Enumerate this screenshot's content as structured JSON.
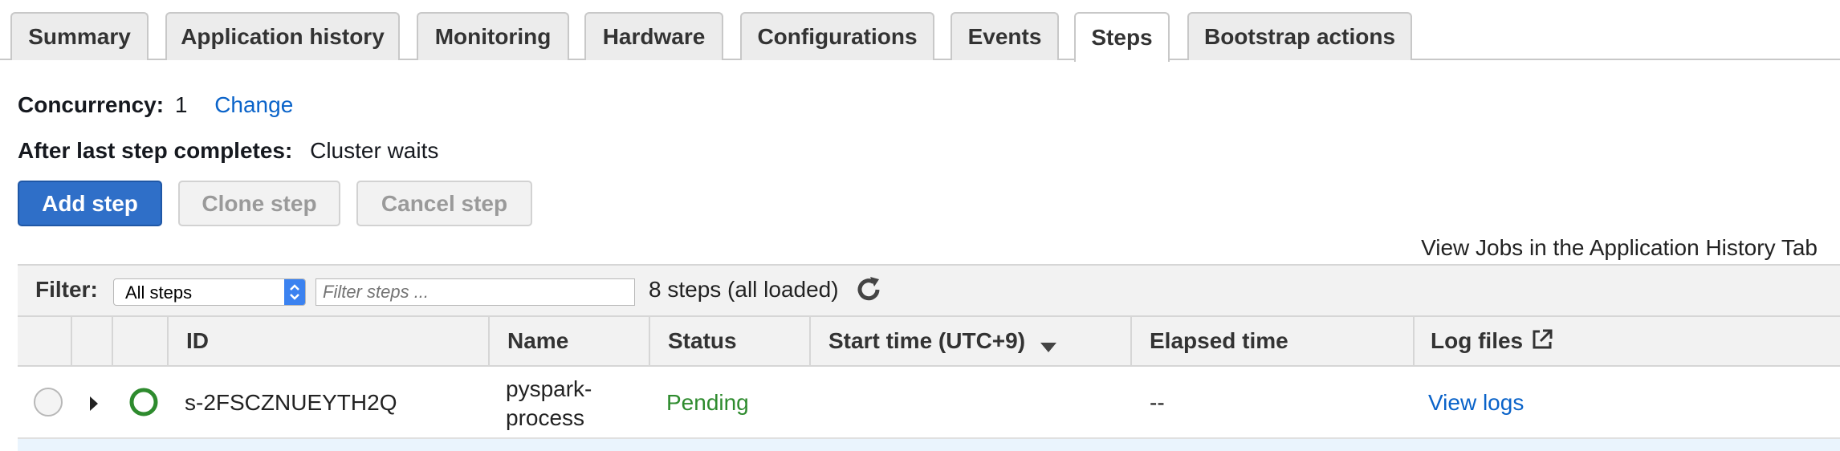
{
  "tabs": [
    {
      "label": "Summary"
    },
    {
      "label": "Application history"
    },
    {
      "label": "Monitoring"
    },
    {
      "label": "Hardware"
    },
    {
      "label": "Configurations"
    },
    {
      "label": "Events"
    },
    {
      "label": "Steps",
      "active": true
    },
    {
      "label": "Bootstrap actions"
    }
  ],
  "concurrency": {
    "label": "Concurrency:",
    "value": "1",
    "change_link": "Change"
  },
  "after_last_step": {
    "label": "After last step completes:",
    "value": "Cluster waits"
  },
  "buttons": {
    "add": "Add step",
    "clone": "Clone step",
    "cancel": "Cancel step"
  },
  "view_jobs_link": "View Jobs in the Application History Tab",
  "filter": {
    "label": "Filter:",
    "select_value": "All steps",
    "input_placeholder": "Filter steps ...",
    "count_text": "8 steps (all loaded)"
  },
  "table": {
    "columns": {
      "id": "ID",
      "name": "Name",
      "status": "Status",
      "start_time": "Start time (UTC+9)",
      "elapsed": "Elapsed time",
      "log_files": "Log files"
    },
    "rows": [
      {
        "id": "s-2FSCZNUEYTH2Q",
        "name_line1": "pyspark-",
        "name_line2": "process",
        "status": "Pending",
        "start_time": "",
        "elapsed": "--",
        "log_link": "View logs"
      }
    ]
  },
  "colors": {
    "link": "#0a63c9",
    "status_pending": "#2e8b2e",
    "primary": "#2f6fc8"
  },
  "icons": [
    "refresh-icon",
    "sort-desc-icon",
    "external-link-icon",
    "expand-caret-icon",
    "status-ring-icon",
    "select-arrows-icon"
  ]
}
